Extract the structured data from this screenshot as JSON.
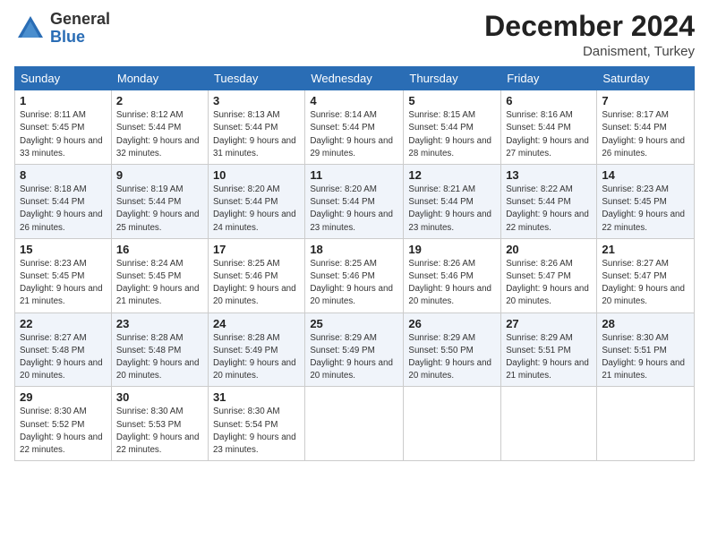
{
  "logo": {
    "general": "General",
    "blue": "Blue"
  },
  "header": {
    "title": "December 2024",
    "subtitle": "Danisment, Turkey"
  },
  "weekdays": [
    "Sunday",
    "Monday",
    "Tuesday",
    "Wednesday",
    "Thursday",
    "Friday",
    "Saturday"
  ],
  "weeks": [
    [
      {
        "day": "1",
        "sunrise": "Sunrise: 8:11 AM",
        "sunset": "Sunset: 5:45 PM",
        "daylight": "Daylight: 9 hours and 33 minutes."
      },
      {
        "day": "2",
        "sunrise": "Sunrise: 8:12 AM",
        "sunset": "Sunset: 5:44 PM",
        "daylight": "Daylight: 9 hours and 32 minutes."
      },
      {
        "day": "3",
        "sunrise": "Sunrise: 8:13 AM",
        "sunset": "Sunset: 5:44 PM",
        "daylight": "Daylight: 9 hours and 31 minutes."
      },
      {
        "day": "4",
        "sunrise": "Sunrise: 8:14 AM",
        "sunset": "Sunset: 5:44 PM",
        "daylight": "Daylight: 9 hours and 29 minutes."
      },
      {
        "day": "5",
        "sunrise": "Sunrise: 8:15 AM",
        "sunset": "Sunset: 5:44 PM",
        "daylight": "Daylight: 9 hours and 28 minutes."
      },
      {
        "day": "6",
        "sunrise": "Sunrise: 8:16 AM",
        "sunset": "Sunset: 5:44 PM",
        "daylight": "Daylight: 9 hours and 27 minutes."
      },
      {
        "day": "7",
        "sunrise": "Sunrise: 8:17 AM",
        "sunset": "Sunset: 5:44 PM",
        "daylight": "Daylight: 9 hours and 26 minutes."
      }
    ],
    [
      {
        "day": "8",
        "sunrise": "Sunrise: 8:18 AM",
        "sunset": "Sunset: 5:44 PM",
        "daylight": "Daylight: 9 hours and 26 minutes."
      },
      {
        "day": "9",
        "sunrise": "Sunrise: 8:19 AM",
        "sunset": "Sunset: 5:44 PM",
        "daylight": "Daylight: 9 hours and 25 minutes."
      },
      {
        "day": "10",
        "sunrise": "Sunrise: 8:20 AM",
        "sunset": "Sunset: 5:44 PM",
        "daylight": "Daylight: 9 hours and 24 minutes."
      },
      {
        "day": "11",
        "sunrise": "Sunrise: 8:20 AM",
        "sunset": "Sunset: 5:44 PM",
        "daylight": "Daylight: 9 hours and 23 minutes."
      },
      {
        "day": "12",
        "sunrise": "Sunrise: 8:21 AM",
        "sunset": "Sunset: 5:44 PM",
        "daylight": "Daylight: 9 hours and 23 minutes."
      },
      {
        "day": "13",
        "sunrise": "Sunrise: 8:22 AM",
        "sunset": "Sunset: 5:44 PM",
        "daylight": "Daylight: 9 hours and 22 minutes."
      },
      {
        "day": "14",
        "sunrise": "Sunrise: 8:23 AM",
        "sunset": "Sunset: 5:45 PM",
        "daylight": "Daylight: 9 hours and 22 minutes."
      }
    ],
    [
      {
        "day": "15",
        "sunrise": "Sunrise: 8:23 AM",
        "sunset": "Sunset: 5:45 PM",
        "daylight": "Daylight: 9 hours and 21 minutes."
      },
      {
        "day": "16",
        "sunrise": "Sunrise: 8:24 AM",
        "sunset": "Sunset: 5:45 PM",
        "daylight": "Daylight: 9 hours and 21 minutes."
      },
      {
        "day": "17",
        "sunrise": "Sunrise: 8:25 AM",
        "sunset": "Sunset: 5:46 PM",
        "daylight": "Daylight: 9 hours and 20 minutes."
      },
      {
        "day": "18",
        "sunrise": "Sunrise: 8:25 AM",
        "sunset": "Sunset: 5:46 PM",
        "daylight": "Daylight: 9 hours and 20 minutes."
      },
      {
        "day": "19",
        "sunrise": "Sunrise: 8:26 AM",
        "sunset": "Sunset: 5:46 PM",
        "daylight": "Daylight: 9 hours and 20 minutes."
      },
      {
        "day": "20",
        "sunrise": "Sunrise: 8:26 AM",
        "sunset": "Sunset: 5:47 PM",
        "daylight": "Daylight: 9 hours and 20 minutes."
      },
      {
        "day": "21",
        "sunrise": "Sunrise: 8:27 AM",
        "sunset": "Sunset: 5:47 PM",
        "daylight": "Daylight: 9 hours and 20 minutes."
      }
    ],
    [
      {
        "day": "22",
        "sunrise": "Sunrise: 8:27 AM",
        "sunset": "Sunset: 5:48 PM",
        "daylight": "Daylight: 9 hours and 20 minutes."
      },
      {
        "day": "23",
        "sunrise": "Sunrise: 8:28 AM",
        "sunset": "Sunset: 5:48 PM",
        "daylight": "Daylight: 9 hours and 20 minutes."
      },
      {
        "day": "24",
        "sunrise": "Sunrise: 8:28 AM",
        "sunset": "Sunset: 5:49 PM",
        "daylight": "Daylight: 9 hours and 20 minutes."
      },
      {
        "day": "25",
        "sunrise": "Sunrise: 8:29 AM",
        "sunset": "Sunset: 5:49 PM",
        "daylight": "Daylight: 9 hours and 20 minutes."
      },
      {
        "day": "26",
        "sunrise": "Sunrise: 8:29 AM",
        "sunset": "Sunset: 5:50 PM",
        "daylight": "Daylight: 9 hours and 20 minutes."
      },
      {
        "day": "27",
        "sunrise": "Sunrise: 8:29 AM",
        "sunset": "Sunset: 5:51 PM",
        "daylight": "Daylight: 9 hours and 21 minutes."
      },
      {
        "day": "28",
        "sunrise": "Sunrise: 8:30 AM",
        "sunset": "Sunset: 5:51 PM",
        "daylight": "Daylight: 9 hours and 21 minutes."
      }
    ],
    [
      {
        "day": "29",
        "sunrise": "Sunrise: 8:30 AM",
        "sunset": "Sunset: 5:52 PM",
        "daylight": "Daylight: 9 hours and 22 minutes."
      },
      {
        "day": "30",
        "sunrise": "Sunrise: 8:30 AM",
        "sunset": "Sunset: 5:53 PM",
        "daylight": "Daylight: 9 hours and 22 minutes."
      },
      {
        "day": "31",
        "sunrise": "Sunrise: 8:30 AM",
        "sunset": "Sunset: 5:54 PM",
        "daylight": "Daylight: 9 hours and 23 minutes."
      },
      null,
      null,
      null,
      null
    ]
  ]
}
